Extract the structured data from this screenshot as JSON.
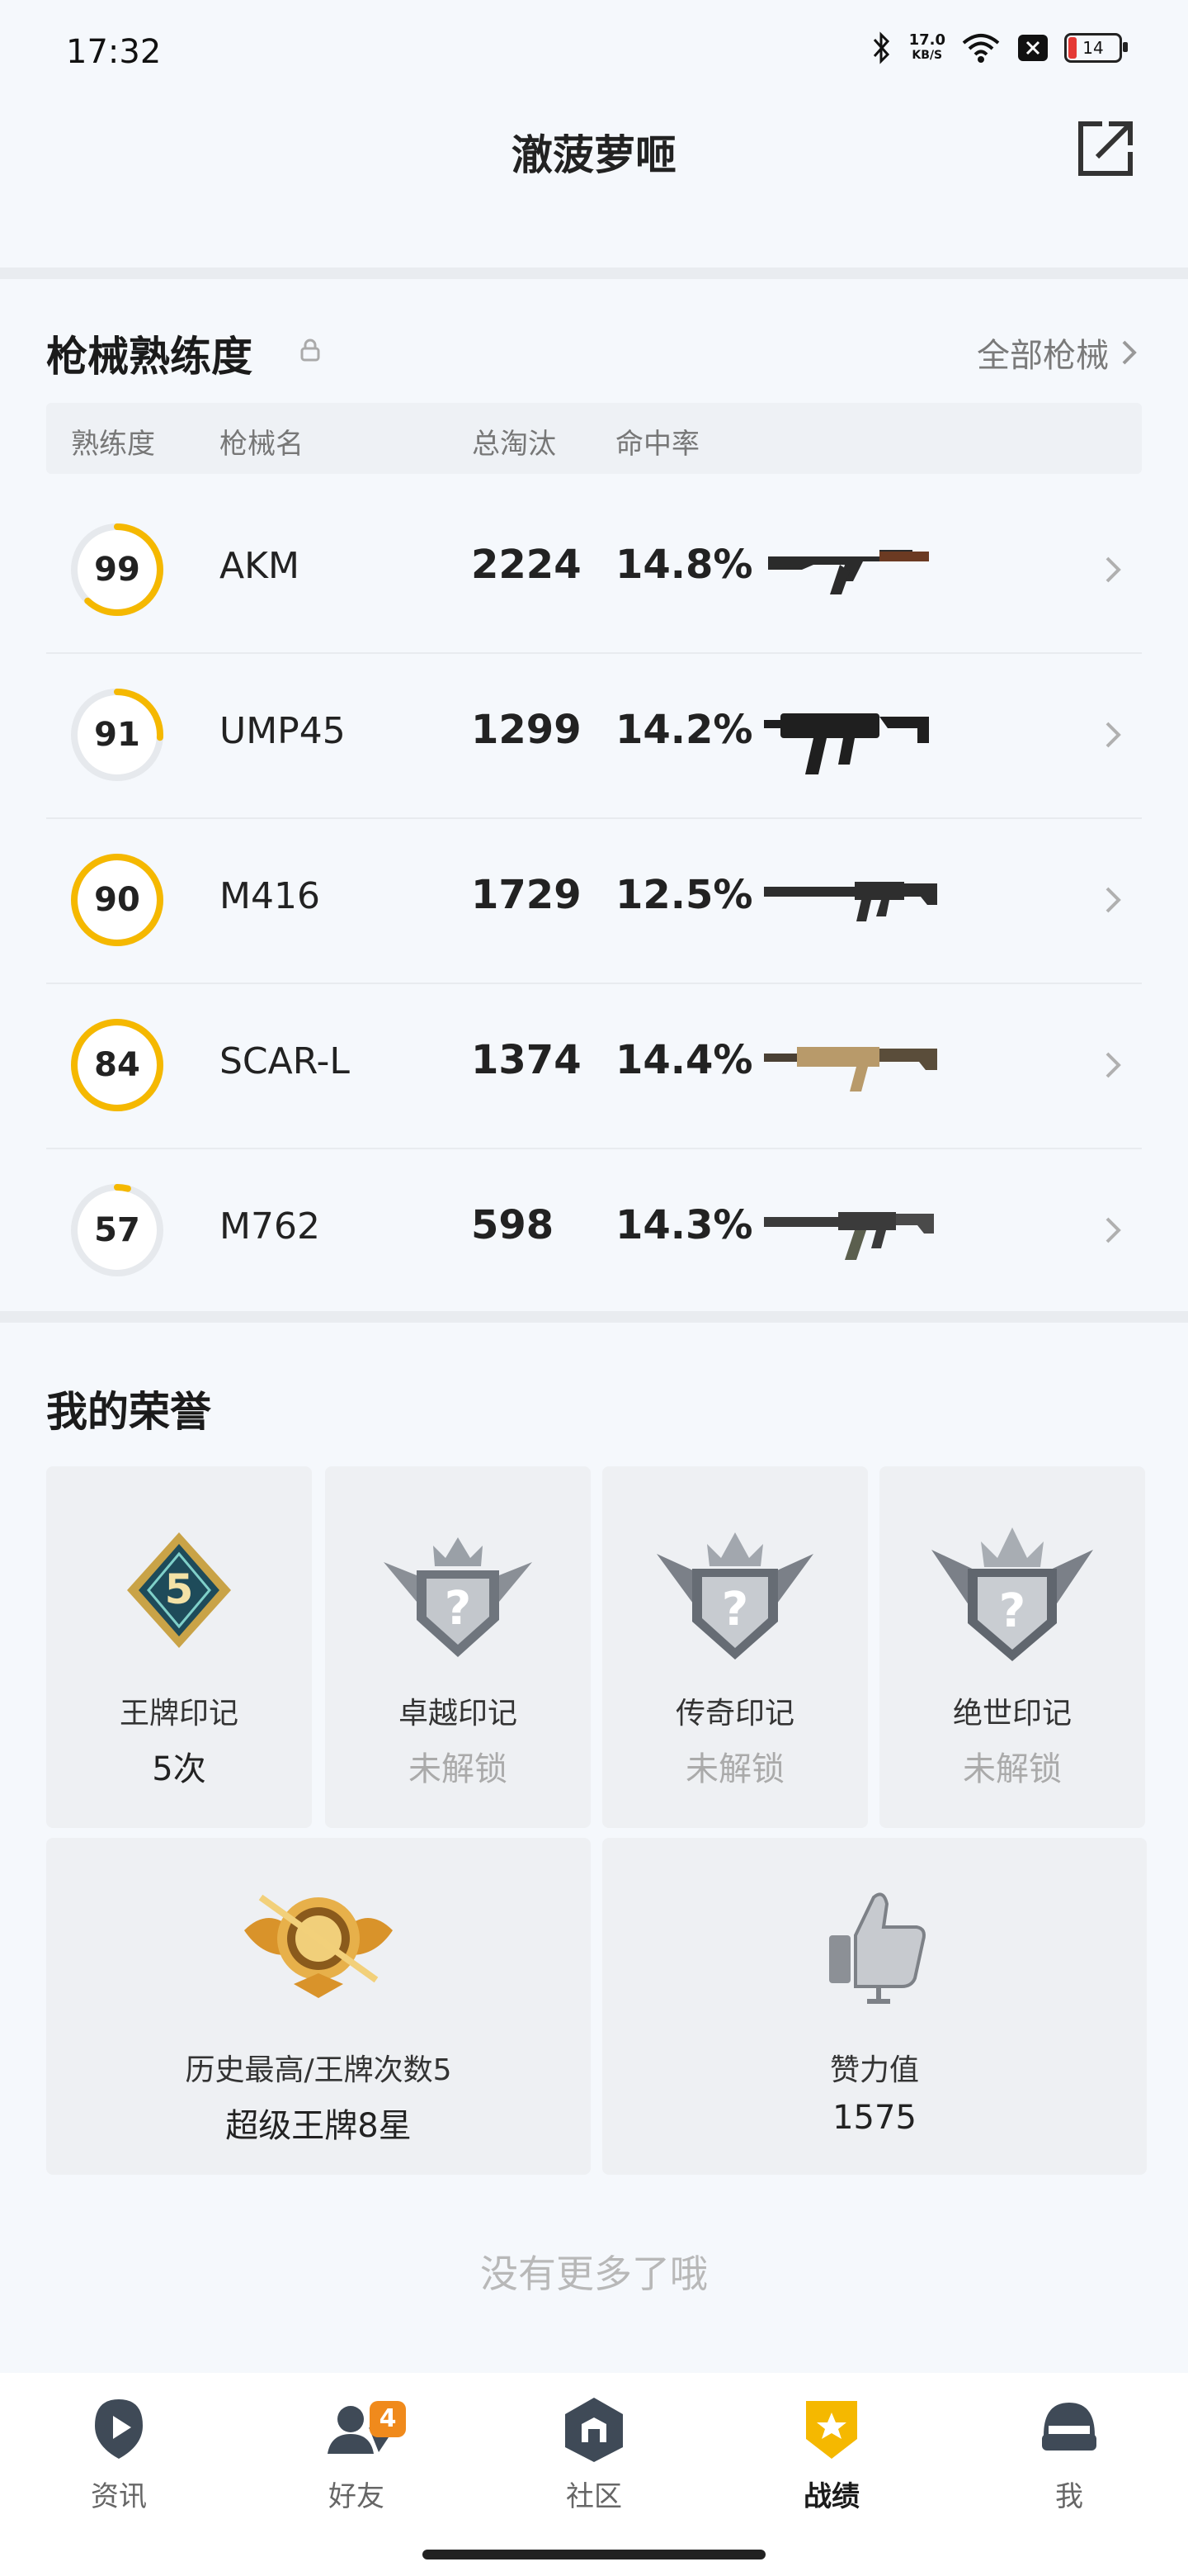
{
  "status_bar": {
    "time": "17:32",
    "speed": "17.0",
    "speed_unit": "KB/S",
    "battery": "14"
  },
  "header": {
    "title": "澈菠萝咂"
  },
  "gun_section": {
    "title": "枪械熟练度",
    "all_link": "全部枪械",
    "columns": [
      "熟练度",
      "枪械名",
      "总淘汰",
      "命中率"
    ],
    "rows": [
      {
        "level": "99",
        "progress": 0.62,
        "name": "AKM",
        "kills": "2224",
        "accuracy": "14.8%",
        "icon": "akm-gun-icon"
      },
      {
        "level": "91",
        "progress": 0.26,
        "name": "UMP45",
        "kills": "1299",
        "accuracy": "14.2%",
        "icon": "ump45-gun-icon"
      },
      {
        "level": "90",
        "progress": 1.0,
        "name": "M416",
        "kills": "1729",
        "accuracy": "12.5%",
        "icon": "m416-gun-icon"
      },
      {
        "level": "84",
        "progress": 1.0,
        "name": "SCAR-L",
        "kills": "1374",
        "accuracy": "14.4%",
        "icon": "scarl-gun-icon"
      },
      {
        "level": "57",
        "progress": 0.04,
        "name": "M762",
        "kills": "598",
        "accuracy": "14.3%",
        "icon": "m762-gun-icon"
      }
    ]
  },
  "honor_section": {
    "title": "我的荣誉",
    "small_cards": [
      {
        "label": "王牌印记",
        "value": "5次",
        "badge_text": "5",
        "locked": false
      },
      {
        "label": "卓越印记",
        "value": "未解锁",
        "badge_text": "?",
        "locked": true
      },
      {
        "label": "传奇印记",
        "value": "未解锁",
        "badge_text": "?",
        "locked": true
      },
      {
        "label": "绝世印记",
        "value": "未解锁",
        "badge_text": "?",
        "locked": true
      }
    ],
    "big_cards": [
      {
        "label": "历史最高/王牌次数5",
        "value": "超级王牌8星"
      },
      {
        "label": "赞力值",
        "value": "1575"
      }
    ]
  },
  "footer_text": "没有更多了哦",
  "bottom_nav": [
    {
      "label": "资讯",
      "icon": "news-icon",
      "active": false
    },
    {
      "label": "好友",
      "icon": "friends-icon",
      "active": false,
      "badge": "4"
    },
    {
      "label": "社区",
      "icon": "community-icon",
      "active": false
    },
    {
      "label": "战绩",
      "icon": "record-icon",
      "active": true
    },
    {
      "label": "我",
      "icon": "profile-icon",
      "active": false
    }
  ],
  "colors": {
    "accent": "#f5b800",
    "ring_track": "#e6e9ed",
    "nav_badge": "#f08a1c"
  }
}
